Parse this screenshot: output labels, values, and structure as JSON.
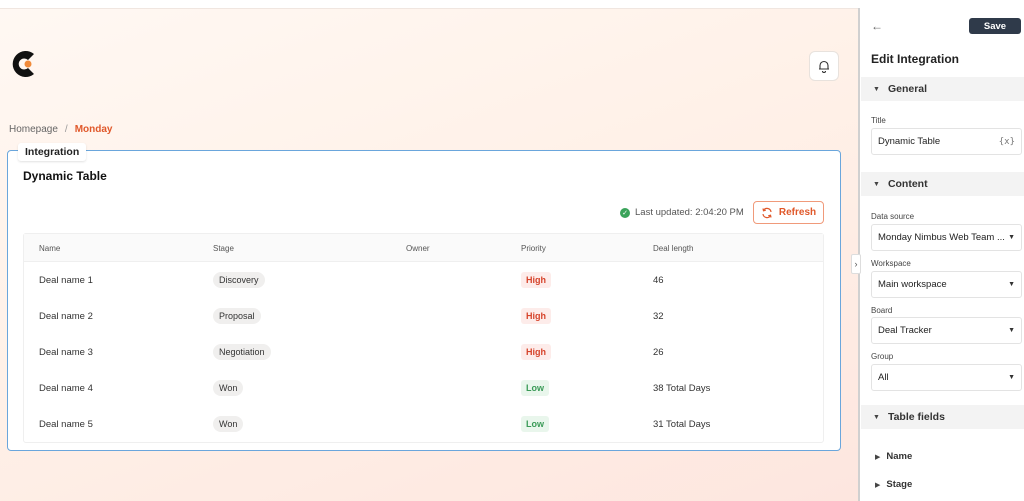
{
  "breadcrumb": {
    "home": "Homepage",
    "separator": "/",
    "current": "Monday"
  },
  "card": {
    "tab_label": "Integration",
    "title": "Dynamic Table",
    "last_updated": "Last updated: 2:04:20 PM",
    "refresh_label": "Refresh"
  },
  "table": {
    "headers": [
      "Name",
      "Stage",
      "Owner",
      "Priority",
      "Deal length"
    ],
    "rows": [
      {
        "name": "Deal name 1",
        "stage": "Discovery",
        "owner": "",
        "priority": "High",
        "deal_length": "46"
      },
      {
        "name": "Deal name 2",
        "stage": "Proposal",
        "owner": "",
        "priority": "High",
        "deal_length": "32"
      },
      {
        "name": "Deal name 3",
        "stage": "Negotiation",
        "owner": "",
        "priority": "High",
        "deal_length": "26"
      },
      {
        "name": "Deal name 4",
        "stage": "Won",
        "owner": "",
        "priority": "Low",
        "deal_length": "38 Total Days"
      },
      {
        "name": "Deal name 5",
        "stage": "Won",
        "owner": "",
        "priority": "Low",
        "deal_length": "31 Total Days"
      }
    ]
  },
  "panel": {
    "save_label": "Save",
    "title": "Edit Integration",
    "general": {
      "heading": "General",
      "title_label": "Title",
      "title_value": "Dynamic Table",
      "variable_icon": "{x}"
    },
    "content": {
      "heading": "Content",
      "data_source_label": "Data source",
      "data_source_value": "Monday Nimbus Web Team ...",
      "workspace_label": "Workspace",
      "workspace_value": "Main workspace",
      "board_label": "Board",
      "board_value": "Deal Tracker",
      "group_label": "Group",
      "group_value": "All"
    },
    "table_fields": {
      "heading": "Table fields",
      "items": [
        "Name",
        "Stage"
      ]
    }
  },
  "colors": {
    "accent": "#e0582a",
    "card_border": "#6aa6dc",
    "save_button": "#2f3a4a",
    "high": "#d6432a",
    "low": "#3a9a57"
  },
  "icons": [
    "logo-icon",
    "bell-icon",
    "check-circle-icon",
    "refresh-icon",
    "arrow-left-icon",
    "chevron-right-icon",
    "caret-down-icon",
    "caret-right-icon",
    "variable-icon"
  ]
}
